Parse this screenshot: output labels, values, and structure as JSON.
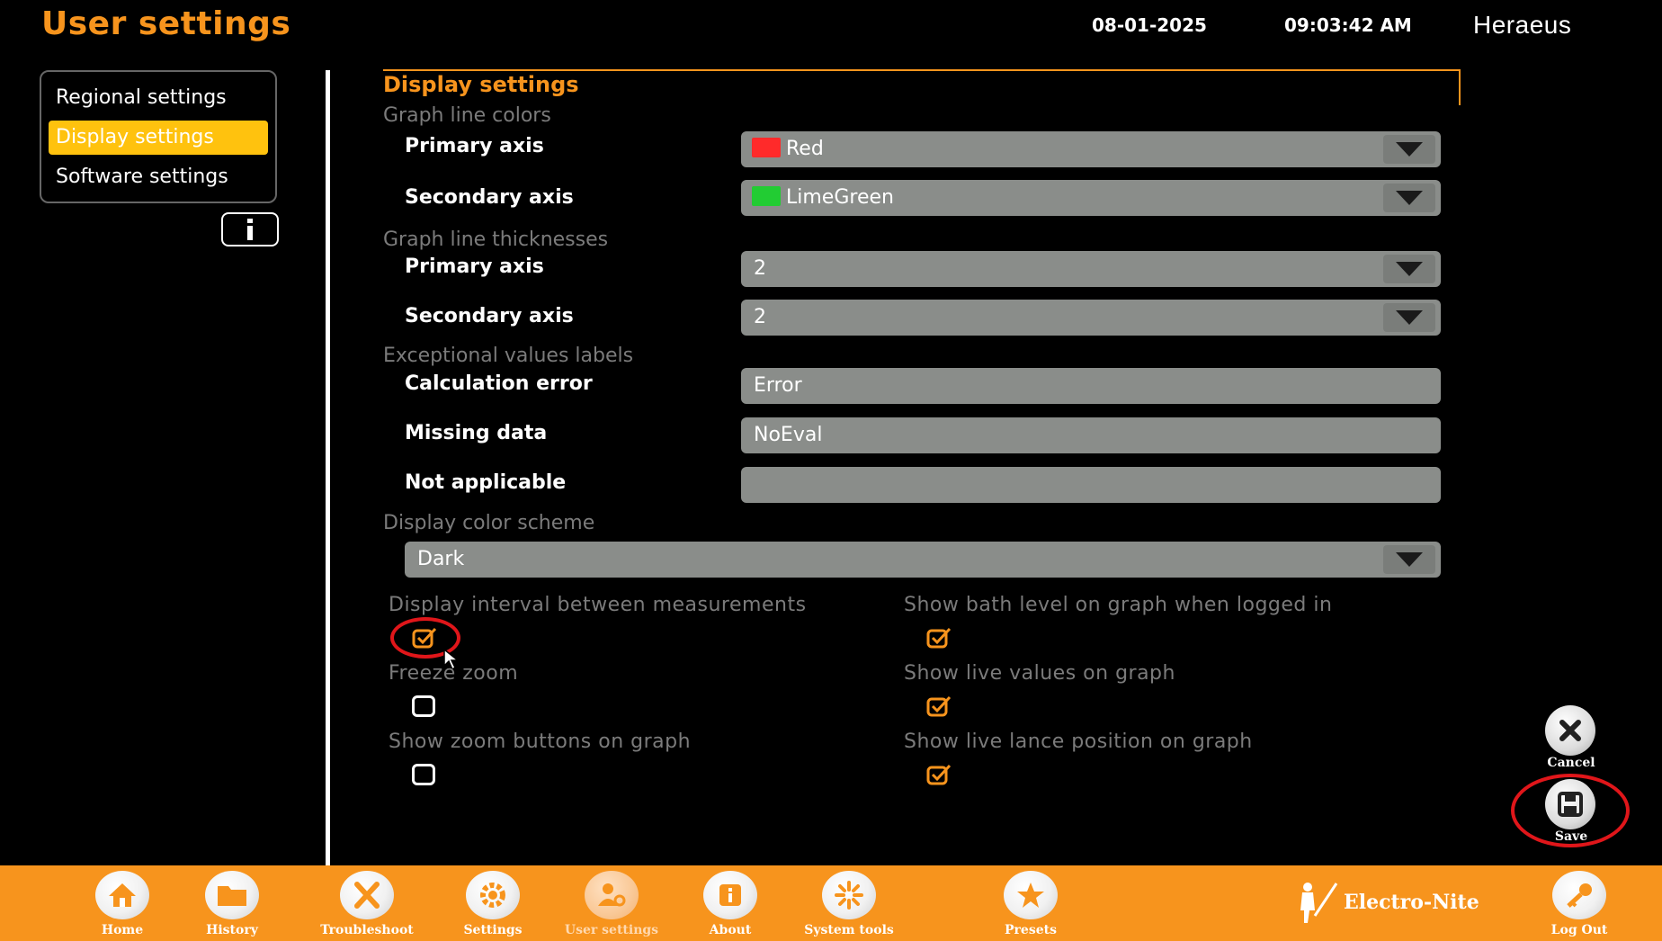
{
  "header": {
    "title": "User settings",
    "date": "08-01-2025",
    "time": "09:03:42 AM",
    "brand": "Heraeus"
  },
  "sidebar": {
    "items": [
      {
        "label": "Regional settings",
        "active": false
      },
      {
        "label": "Display settings",
        "active": true
      },
      {
        "label": "Software settings",
        "active": false
      }
    ],
    "info_icon": "info-icon"
  },
  "content": {
    "section_title": "Display settings",
    "graph_line_colors": {
      "label": "Graph line colors",
      "primary": {
        "label": "Primary axis",
        "value": "Red",
        "swatch": "#ff2a2a"
      },
      "secondary": {
        "label": "Secondary axis",
        "value": "LimeGreen",
        "swatch": "#22cc33"
      }
    },
    "graph_line_thicknesses": {
      "label": "Graph line thicknesses",
      "primary": {
        "label": "Primary axis",
        "value": "2"
      },
      "secondary": {
        "label": "Secondary axis",
        "value": "2"
      }
    },
    "exceptional_values": {
      "label": "Exceptional values labels",
      "calculation_error": {
        "label": "Calculation error",
        "value": "Error"
      },
      "missing_data": {
        "label": "Missing data",
        "value": "NoEval"
      },
      "not_applicable": {
        "label": "Not applicable",
        "value": ""
      }
    },
    "color_scheme": {
      "label": "Display color scheme",
      "value": "Dark"
    },
    "checkboxes": {
      "display_interval": {
        "label": "Display interval between measurements",
        "checked": true
      },
      "freeze_zoom": {
        "label": "Freeze zoom",
        "checked": false
      },
      "zoom_buttons": {
        "label": "Show zoom buttons on graph",
        "checked": false
      },
      "bath_level": {
        "label": "Show bath level on graph when logged in",
        "checked": true
      },
      "live_values": {
        "label": "Show live values on graph",
        "checked": true
      },
      "lance_position": {
        "label": "Show live lance position on graph",
        "checked": true
      }
    }
  },
  "actions": {
    "cancel": "Cancel",
    "save": "Save"
  },
  "bottom_nav": {
    "items": [
      "Home",
      "History",
      "Troubleshoot",
      "Settings",
      "User settings",
      "About",
      "System tools",
      "Presets"
    ],
    "logo": "Electro-Nite",
    "logout": "Log Out"
  },
  "colors": {
    "accent": "#f7941d",
    "active_nav": "#ffc20e",
    "field_bg": "#8a8d8a",
    "highlight": "#e0161a"
  }
}
